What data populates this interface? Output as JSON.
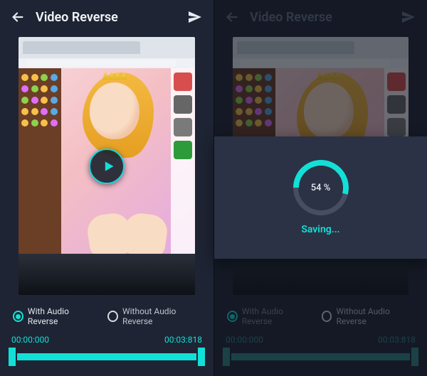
{
  "left": {
    "title": "Video Reverse",
    "options": {
      "with_label": "With Audio Reverse",
      "without_label": "Without Audio  Reverse",
      "selected": "with"
    },
    "time_start": "00:00:000",
    "time_end": "00:03:818"
  },
  "right": {
    "title": "Video Reverse",
    "options": {
      "with_label": "With Audio Reverse",
      "without_label": "Without Audio  Reverse",
      "selected": "with"
    },
    "time_start": "00:00:000",
    "time_end": "00:03:818",
    "modal": {
      "percent_label": "54 %",
      "percent_value": 54,
      "status": "Saving..."
    }
  },
  "colors": {
    "accent": "#12e0d7"
  }
}
